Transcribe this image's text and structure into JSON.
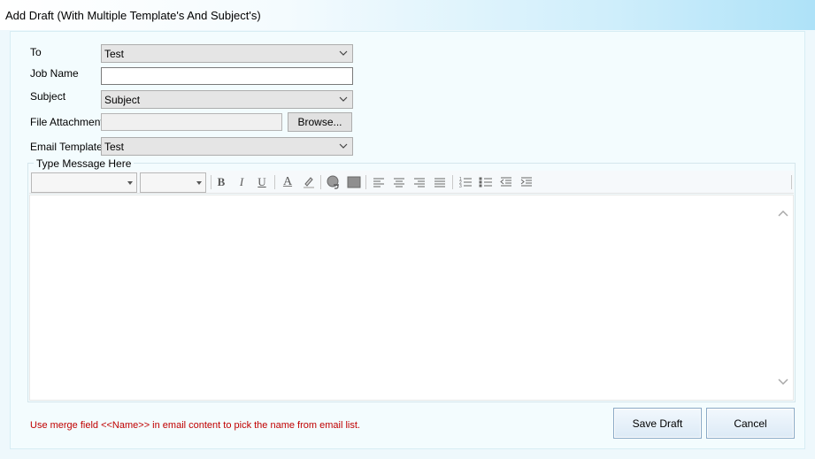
{
  "window": {
    "title": "Add Draft (With Multiple Template's And Subject's)"
  },
  "form": {
    "to": {
      "label": "To",
      "value": "Test"
    },
    "job_name": {
      "label": "Job Name",
      "value": ""
    },
    "subject": {
      "label": "Subject",
      "value": "Subject"
    },
    "file_attachment": {
      "label": "File Attachment",
      "value": "",
      "browse_label": "Browse..."
    },
    "email_template": {
      "label": "Email Template",
      "value": "Test"
    }
  },
  "message": {
    "group_label": "Type Message Here",
    "toolbar": {
      "font_family": "",
      "font_size": "",
      "bold": "B",
      "italic": "I",
      "underline": "U",
      "font_color": "A",
      "icons": [
        "bold-icon",
        "italic-icon",
        "underline-icon",
        "font-color-icon",
        "highlight-icon",
        "insert-link-icon",
        "insert-image-icon",
        "align-left-icon",
        "align-center-icon",
        "align-right-icon",
        "justify-icon",
        "numbered-list-icon",
        "bullet-list-icon",
        "outdent-icon",
        "indent-icon"
      ]
    },
    "body": ""
  },
  "footer": {
    "note": "Use merge field <<Name>> in email content to pick the name from email list.",
    "save_label": "Save Draft",
    "cancel_label": "Cancel"
  },
  "colors": {
    "note": "#c00000",
    "title_gradient_end": "#aee2f8"
  }
}
